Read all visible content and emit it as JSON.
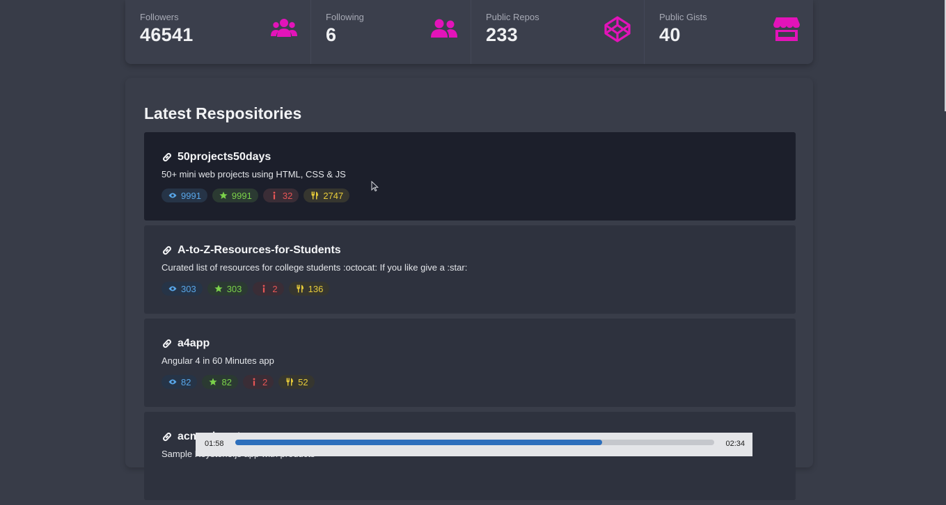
{
  "stats": [
    {
      "label": "Followers",
      "value": "46541",
      "icon": "users-icon"
    },
    {
      "label": "Following",
      "value": "6",
      "icon": "user-friends-icon"
    },
    {
      "label": "Public Repos",
      "value": "233",
      "icon": "codepen-icon"
    },
    {
      "label": "Public Gists",
      "value": "40",
      "icon": "store-icon"
    }
  ],
  "colors": {
    "accent": "#e313b9",
    "watch": "#58a6e8",
    "star": "#7bd24a",
    "issue": "#e85656",
    "fork": "#e8cc3a"
  },
  "repos_section": {
    "title": "Latest Respositories",
    "repos": [
      {
        "name": "50projects50days",
        "description": "50+ mini web projects using HTML, CSS & JS",
        "watchers": "9991",
        "stars": "9991",
        "issues": "32",
        "forks": "2747"
      },
      {
        "name": "A-to-Z-Resources-for-Students",
        "description": "Curated list of resources for college students :octocat: If you like give a :star:",
        "watchers": "303",
        "stars": "303",
        "issues": "2",
        "forks": "136"
      },
      {
        "name": "a4app",
        "description": "Angular 4 in 60 Minutes app",
        "watchers": "82",
        "stars": "82",
        "issues": "2",
        "forks": "52"
      },
      {
        "name": "acme_keystone",
        "description": "Sample Keystone.js app with products",
        "watchers": "",
        "stars": "",
        "issues": "",
        "forks": ""
      }
    ]
  },
  "player": {
    "current_time": "01:58",
    "total_time": "02:34",
    "progress": 0.766
  }
}
